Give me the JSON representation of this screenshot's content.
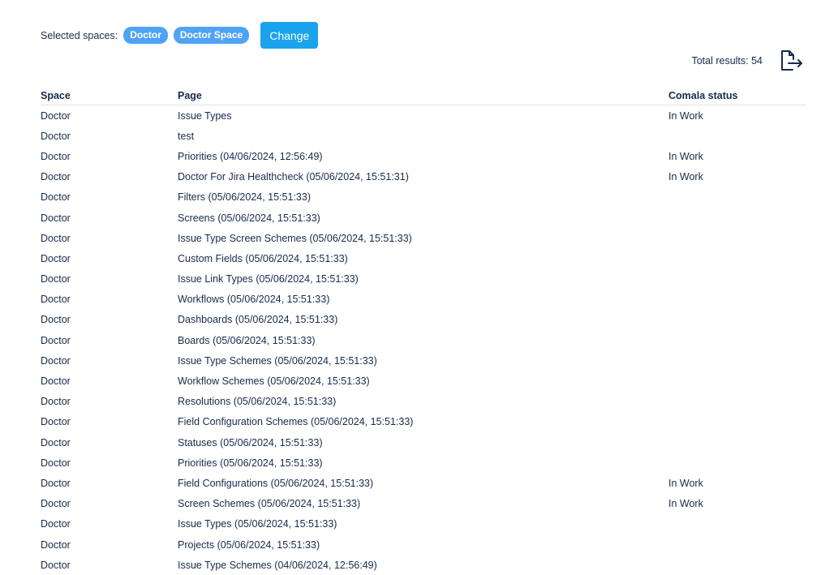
{
  "selection": {
    "label": "Selected spaces:",
    "chips": [
      "Doctor",
      "Doctor Space"
    ],
    "change_label": "Change"
  },
  "summary": {
    "total_text": "Total results: 54"
  },
  "export_icon": "export-document-icon",
  "table": {
    "headers": [
      "Space",
      "Page",
      "Comala status"
    ],
    "rows": [
      [
        "Doctor",
        "Issue Types",
        "In Work"
      ],
      [
        "Doctor",
        "test",
        ""
      ],
      [
        "Doctor",
        "Priorities (04/06/2024, 12:56:49)",
        "In Work"
      ],
      [
        "Doctor",
        "Doctor For Jira Healthcheck (05/06/2024, 15:51:31)",
        "In Work"
      ],
      [
        "Doctor",
        "Filters (05/06/2024, 15:51:33)",
        ""
      ],
      [
        "Doctor",
        "Screens (05/06/2024, 15:51:33)",
        ""
      ],
      [
        "Doctor",
        "Issue Type Screen Schemes (05/06/2024, 15:51:33)",
        ""
      ],
      [
        "Doctor",
        "Custom Fields (05/06/2024, 15:51:33)",
        ""
      ],
      [
        "Doctor",
        "Issue Link Types (05/06/2024, 15:51:33)",
        ""
      ],
      [
        "Doctor",
        "Workflows (05/06/2024, 15:51:33)",
        ""
      ],
      [
        "Doctor",
        "Dashboards (05/06/2024, 15:51:33)",
        ""
      ],
      [
        "Doctor",
        "Boards (05/06/2024, 15:51:33)",
        ""
      ],
      [
        "Doctor",
        "Issue Type Schemes (05/06/2024, 15:51:33)",
        ""
      ],
      [
        "Doctor",
        "Workflow Schemes (05/06/2024, 15:51:33)",
        ""
      ],
      [
        "Doctor",
        "Resolutions (05/06/2024, 15:51:33)",
        ""
      ],
      [
        "Doctor",
        "Field Configuration Schemes (05/06/2024, 15:51:33)",
        ""
      ],
      [
        "Doctor",
        "Statuses (05/06/2024, 15:51:33)",
        ""
      ],
      [
        "Doctor",
        "Priorities (05/06/2024, 15:51:33)",
        ""
      ],
      [
        "Doctor",
        "Field Configurations (05/06/2024, 15:51:33)",
        "In Work"
      ],
      [
        "Doctor",
        "Screen Schemes (05/06/2024, 15:51:33)",
        "In Work"
      ],
      [
        "Doctor",
        "Issue Types (05/06/2024, 15:51:33)",
        ""
      ],
      [
        "Doctor",
        "Projects (05/06/2024, 15:51:33)",
        ""
      ],
      [
        "Doctor",
        "Issue Type Schemes (04/06/2024, 12:56:49)",
        ""
      ]
    ]
  }
}
